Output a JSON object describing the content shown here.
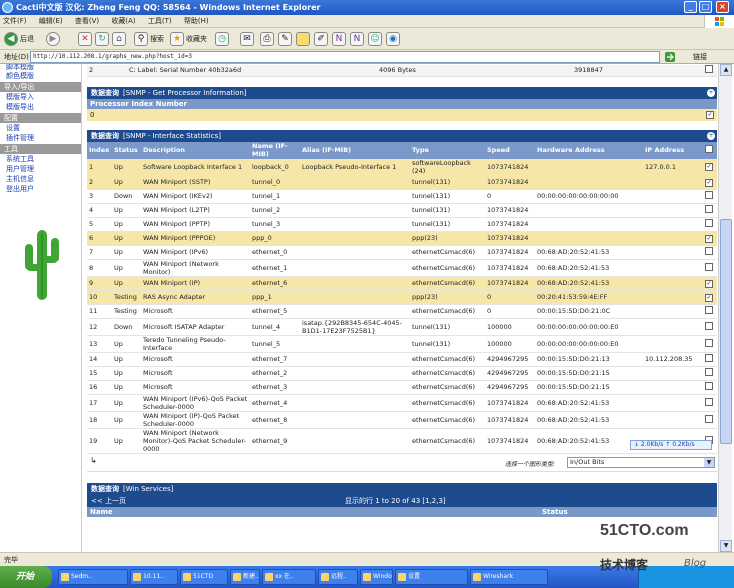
{
  "window": {
    "title": "Cacti中文版 汉化: Zheng Feng QQ: 58564 - Windows Internet Explorer",
    "min": "_",
    "max": "□",
    "close": "×"
  },
  "menu": [
    "文件(F)",
    "编辑(E)",
    "查看(V)",
    "收藏(A)",
    "工具(T)",
    "帮助(H)"
  ],
  "toolbar": {
    "back": "后退",
    "search": "搜索",
    "favorites": "收藏夹"
  },
  "address": {
    "label": "地址(D)",
    "url": "http://10.112.208.1/graphs_new.php?host_id=3",
    "go": "转到",
    "links": "链接"
  },
  "sidebar": {
    "top": [
      "脚本模版"
    ],
    "groups": [
      {
        "header": "",
        "items": [
          "颜色模版"
        ]
      },
      {
        "header": "导入/导出",
        "items": [
          "模版导入",
          "模版导出"
        ]
      },
      {
        "header": "配置",
        "items": [
          "设置",
          "插件管理"
        ]
      },
      {
        "header": "工具",
        "items": [
          "系统工具",
          "用户管理",
          "主机信息",
          "登出用户"
        ]
      }
    ]
  },
  "top_row": {
    "index": "2",
    "desc": "C: Label: Serial Number 40b32a6d",
    "size": "4096 Bytes",
    "value": "3918847"
  },
  "proc_query": {
    "title": "数据查询",
    "subtitle": "[SNMP - Get Processor Information]",
    "col": "Processor Index Number",
    "value": "0"
  },
  "iface_query": {
    "title": "数据查询",
    "subtitle": "[SNMP - Interface Statistics]",
    "columns": [
      "Index",
      "Status",
      "Description",
      "Name (IF-MIB)",
      "Alias (IF-MIB)",
      "Type",
      "Speed",
      "Hardware Address",
      "IP Address"
    ],
    "rows": [
      {
        "i": "1",
        "s": "Up",
        "d": "Software Loopback Interface 1",
        "n": "loopback_0",
        "a": "Loopback Pseudo-Interface 1",
        "t": "softwareLoopback (24)",
        "sp": "1073741824",
        "hw": "",
        "ip": "127.0.0.1",
        "hl": true,
        "chk": true
      },
      {
        "i": "2",
        "s": "Up",
        "d": "WAN Miniport (SSTP)",
        "n": "tunnel_0",
        "a": "",
        "t": "tunnel(131)",
        "sp": "1073741824",
        "hw": "",
        "ip": "",
        "hl": true,
        "chk": true
      },
      {
        "i": "3",
        "s": "Down",
        "d": "WAN Miniport (IKEv2)",
        "n": "tunnel_1",
        "a": "",
        "t": "tunnel(131)",
        "sp": "0",
        "hw": "00:00:00:00:00:00:00:00",
        "ip": "",
        "hl": false,
        "chk": false
      },
      {
        "i": "4",
        "s": "Up",
        "d": "WAN Miniport (L2TP)",
        "n": "tunnel_2",
        "a": "",
        "t": "tunnel(131)",
        "sp": "1073741824",
        "hw": "",
        "ip": "",
        "hl": false,
        "chk": false
      },
      {
        "i": "5",
        "s": "Up",
        "d": "WAN Miniport (PPTP)",
        "n": "tunnel_3",
        "a": "",
        "t": "tunnel(131)",
        "sp": "1073741824",
        "hw": "",
        "ip": "",
        "hl": false,
        "chk": false
      },
      {
        "i": "6",
        "s": "Up",
        "d": "WAN Miniport (PPPOE)",
        "n": "ppp_0",
        "a": "",
        "t": "ppp(23)",
        "sp": "1073741824",
        "hw": "",
        "ip": "",
        "hl": true,
        "chk": true
      },
      {
        "i": "7",
        "s": "Up",
        "d": "WAN Miniport (IPv6)",
        "n": "ethernet_0",
        "a": "",
        "t": "ethernetCsmacd(6)",
        "sp": "1073741824",
        "hw": "00:68:AD:20:52:41:53",
        "ip": "",
        "hl": false,
        "chk": false
      },
      {
        "i": "8",
        "s": "Up",
        "d": "WAN Miniport (Network Monitor)",
        "n": "ethernet_1",
        "a": "",
        "t": "ethernetCsmacd(6)",
        "sp": "1073741824",
        "hw": "00:68:AD:20:52:41:53",
        "ip": "",
        "hl": false,
        "chk": false
      },
      {
        "i": "9",
        "s": "Up",
        "d": "WAN Miniport (IP)",
        "n": "ethernet_6",
        "a": "",
        "t": "ethernetCsmacd(6)",
        "sp": "1073741824",
        "hw": "00:68:AD:20:52:41:53",
        "ip": "",
        "hl": true,
        "chk": true
      },
      {
        "i": "10",
        "s": "Testing",
        "d": "RAS Async Adapter",
        "n": "ppp_1",
        "a": "",
        "t": "ppp(23)",
        "sp": "0",
        "hw": "00:20:41:53:59:4E:FF",
        "ip": "",
        "hl": true,
        "chk": true
      },
      {
        "i": "11",
        "s": "Testing",
        "d": "Microsoft",
        "n": "ethernet_5",
        "a": "",
        "t": "ethernetCsmacd(6)",
        "sp": "0",
        "hw": "00:00:15:5D:D0:21:0C",
        "ip": "",
        "hl": false,
        "chk": false
      },
      {
        "i": "12",
        "s": "Down",
        "d": "Microsoft ISATAP Adapter",
        "n": "tunnel_4",
        "a": "isatap.{292B8345-654C-4045-B1D1-17E23F7525B1}",
        "t": "tunnel(131)",
        "sp": "100000",
        "hw": "00:00:00:00:00:00:00:E0",
        "ip": "",
        "hl": false,
        "chk": false
      },
      {
        "i": "13",
        "s": "Up",
        "d": "Teredo Tunneling Pseudo-Interface",
        "n": "tunnel_5",
        "a": "",
        "t": "tunnel(131)",
        "sp": "100000",
        "hw": "00:00:00:00:00:00:00:E0",
        "ip": "",
        "hl": false,
        "chk": false
      },
      {
        "i": "14",
        "s": "Up",
        "d": "Microsoft",
        "n": "ethernet_7",
        "a": "",
        "t": "ethernetCsmacd(6)",
        "sp": "4294967295",
        "hw": "00:00:15:5D:D0:21:13",
        "ip": "10.112.208.35",
        "hl": false,
        "chk": false
      },
      {
        "i": "15",
        "s": "Up",
        "d": "Microsoft",
        "n": "ethernet_2",
        "a": "",
        "t": "ethernetCsmacd(6)",
        "sp": "4294967295",
        "hw": "00:00:15:5D:D0:21:15",
        "ip": "",
        "hl": false,
        "chk": false
      },
      {
        "i": "16",
        "s": "Up",
        "d": "Microsoft",
        "n": "ethernet_3",
        "a": "",
        "t": "ethernetCsmacd(6)",
        "sp": "4294967295",
        "hw": "00:00:15:5D:D0:21:15",
        "ip": "",
        "hl": false,
        "chk": false
      },
      {
        "i": "17",
        "s": "Up",
        "d": "WAN Miniport (IPv6)-QoS Packet Scheduler-0000",
        "n": "ethernet_4",
        "a": "",
        "t": "ethernetCsmacd(6)",
        "sp": "1073741824",
        "hw": "00:68:AD:20:52:41:53",
        "ip": "",
        "hl": false,
        "chk": false
      },
      {
        "i": "18",
        "s": "Up",
        "d": "WAN Miniport (IP)-QoS Packet Scheduler-0000",
        "n": "ethernet_8",
        "a": "",
        "t": "ethernetCsmacd(6)",
        "sp": "1073741824",
        "hw": "00:68:AD:20:52:41:53",
        "ip": "",
        "hl": false,
        "chk": false
      },
      {
        "i": "19",
        "s": "Up",
        "d": "WAN Miniport (Network Monitor)-QoS Packet Scheduler-0000",
        "n": "ethernet_9",
        "a": "",
        "t": "ethernetCsmacd(6)",
        "sp": "1073741824",
        "hw": "00:68:AD:20:52:41:53",
        "ip": "",
        "hl": false,
        "chk": false
      }
    ],
    "select_label": "选择一个图形类型:",
    "select_value": "In/Out Bits"
  },
  "win_services": {
    "title": "数据查询",
    "subtitle": "[Win Services]",
    "prev": "<< 上一页",
    "paging": "显示的行 1 to 20 of 43 [1,2,3]",
    "col_name": "Name",
    "col_status": "Status"
  },
  "tooltip": "↓ 2.0Kb/s ↑ 0.2Kb/s",
  "statusbar": "完毕",
  "taskbar": {
    "start": "开始",
    "items": [
      "Sedm..",
      "10.11..",
      "51CTO",
      "新建..",
      "xx 在..",
      "远程..",
      "Windo..",
      "设置",
      "Wireshark"
    ]
  },
  "watermark": {
    "site": "51CTO.com",
    "line1": "技术博客",
    "line2": "Blog"
  }
}
